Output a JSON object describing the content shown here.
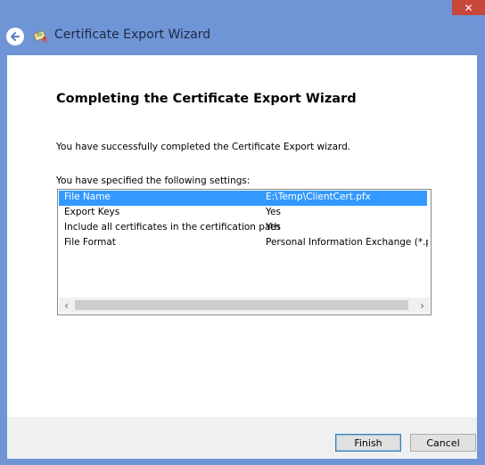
{
  "window": {
    "title": "Certificate Export Wizard",
    "close_glyph": "✕"
  },
  "header": {
    "back_glyph": "←"
  },
  "page": {
    "heading": "Completing the Certificate Export Wizard",
    "success_text": "You have successfully completed the Certificate Export wizard.",
    "settings_label": "You have specified the following settings:"
  },
  "settings": {
    "rows": [
      {
        "name": "File Name",
        "value": "E:\\Temp\\ClientCert.pfx",
        "selected": true
      },
      {
        "name": "Export Keys",
        "value": "Yes",
        "selected": false
      },
      {
        "name": "Include all certificates in the certification path",
        "value": "Yes",
        "selected": false
      },
      {
        "name": "File Format",
        "value": "Personal Information Exchange (*.pfx)",
        "selected": false
      }
    ]
  },
  "scrollbar": {
    "left_glyph": "‹",
    "right_glyph": "›"
  },
  "footer": {
    "finish_label": "Finish",
    "cancel_label": "Cancel"
  },
  "colors": {
    "title_bar": "#6f95d6",
    "close_button": "#c7473a",
    "selection": "#3399ff"
  }
}
